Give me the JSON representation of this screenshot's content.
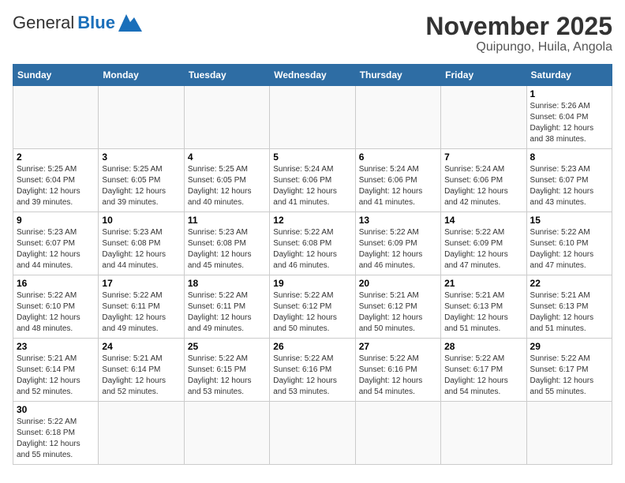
{
  "header": {
    "logo_general": "General",
    "logo_blue": "Blue",
    "title": "November 2025",
    "subtitle": "Quipungo, Huila, Angola"
  },
  "days_of_week": [
    "Sunday",
    "Monday",
    "Tuesday",
    "Wednesday",
    "Thursday",
    "Friday",
    "Saturday"
  ],
  "weeks": [
    [
      {
        "day": "",
        "info": ""
      },
      {
        "day": "",
        "info": ""
      },
      {
        "day": "",
        "info": ""
      },
      {
        "day": "",
        "info": ""
      },
      {
        "day": "",
        "info": ""
      },
      {
        "day": "",
        "info": ""
      },
      {
        "day": "1",
        "info": "Sunrise: 5:26 AM\nSunset: 6:04 PM\nDaylight: 12 hours and 38 minutes."
      }
    ],
    [
      {
        "day": "2",
        "info": "Sunrise: 5:25 AM\nSunset: 6:04 PM\nDaylight: 12 hours and 39 minutes."
      },
      {
        "day": "3",
        "info": "Sunrise: 5:25 AM\nSunset: 6:05 PM\nDaylight: 12 hours and 39 minutes."
      },
      {
        "day": "4",
        "info": "Sunrise: 5:25 AM\nSunset: 6:05 PM\nDaylight: 12 hours and 40 minutes."
      },
      {
        "day": "5",
        "info": "Sunrise: 5:24 AM\nSunset: 6:06 PM\nDaylight: 12 hours and 41 minutes."
      },
      {
        "day": "6",
        "info": "Sunrise: 5:24 AM\nSunset: 6:06 PM\nDaylight: 12 hours and 41 minutes."
      },
      {
        "day": "7",
        "info": "Sunrise: 5:24 AM\nSunset: 6:06 PM\nDaylight: 12 hours and 42 minutes."
      },
      {
        "day": "8",
        "info": "Sunrise: 5:23 AM\nSunset: 6:07 PM\nDaylight: 12 hours and 43 minutes."
      }
    ],
    [
      {
        "day": "9",
        "info": "Sunrise: 5:23 AM\nSunset: 6:07 PM\nDaylight: 12 hours and 44 minutes."
      },
      {
        "day": "10",
        "info": "Sunrise: 5:23 AM\nSunset: 6:08 PM\nDaylight: 12 hours and 44 minutes."
      },
      {
        "day": "11",
        "info": "Sunrise: 5:23 AM\nSunset: 6:08 PM\nDaylight: 12 hours and 45 minutes."
      },
      {
        "day": "12",
        "info": "Sunrise: 5:22 AM\nSunset: 6:08 PM\nDaylight: 12 hours and 46 minutes."
      },
      {
        "day": "13",
        "info": "Sunrise: 5:22 AM\nSunset: 6:09 PM\nDaylight: 12 hours and 46 minutes."
      },
      {
        "day": "14",
        "info": "Sunrise: 5:22 AM\nSunset: 6:09 PM\nDaylight: 12 hours and 47 minutes."
      },
      {
        "day": "15",
        "info": "Sunrise: 5:22 AM\nSunset: 6:10 PM\nDaylight: 12 hours and 47 minutes."
      }
    ],
    [
      {
        "day": "16",
        "info": "Sunrise: 5:22 AM\nSunset: 6:10 PM\nDaylight: 12 hours and 48 minutes."
      },
      {
        "day": "17",
        "info": "Sunrise: 5:22 AM\nSunset: 6:11 PM\nDaylight: 12 hours and 49 minutes."
      },
      {
        "day": "18",
        "info": "Sunrise: 5:22 AM\nSunset: 6:11 PM\nDaylight: 12 hours and 49 minutes."
      },
      {
        "day": "19",
        "info": "Sunrise: 5:22 AM\nSunset: 6:12 PM\nDaylight: 12 hours and 50 minutes."
      },
      {
        "day": "20",
        "info": "Sunrise: 5:21 AM\nSunset: 6:12 PM\nDaylight: 12 hours and 50 minutes."
      },
      {
        "day": "21",
        "info": "Sunrise: 5:21 AM\nSunset: 6:13 PM\nDaylight: 12 hours and 51 minutes."
      },
      {
        "day": "22",
        "info": "Sunrise: 5:21 AM\nSunset: 6:13 PM\nDaylight: 12 hours and 51 minutes."
      }
    ],
    [
      {
        "day": "23",
        "info": "Sunrise: 5:21 AM\nSunset: 6:14 PM\nDaylight: 12 hours and 52 minutes."
      },
      {
        "day": "24",
        "info": "Sunrise: 5:21 AM\nSunset: 6:14 PM\nDaylight: 12 hours and 52 minutes."
      },
      {
        "day": "25",
        "info": "Sunrise: 5:22 AM\nSunset: 6:15 PM\nDaylight: 12 hours and 53 minutes."
      },
      {
        "day": "26",
        "info": "Sunrise: 5:22 AM\nSunset: 6:16 PM\nDaylight: 12 hours and 53 minutes."
      },
      {
        "day": "27",
        "info": "Sunrise: 5:22 AM\nSunset: 6:16 PM\nDaylight: 12 hours and 54 minutes."
      },
      {
        "day": "28",
        "info": "Sunrise: 5:22 AM\nSunset: 6:17 PM\nDaylight: 12 hours and 54 minutes."
      },
      {
        "day": "29",
        "info": "Sunrise: 5:22 AM\nSunset: 6:17 PM\nDaylight: 12 hours and 55 minutes."
      }
    ],
    [
      {
        "day": "30",
        "info": "Sunrise: 5:22 AM\nSunset: 6:18 PM\nDaylight: 12 hours and 55 minutes."
      },
      {
        "day": "",
        "info": ""
      },
      {
        "day": "",
        "info": ""
      },
      {
        "day": "",
        "info": ""
      },
      {
        "day": "",
        "info": ""
      },
      {
        "day": "",
        "info": ""
      },
      {
        "day": "",
        "info": ""
      }
    ]
  ]
}
